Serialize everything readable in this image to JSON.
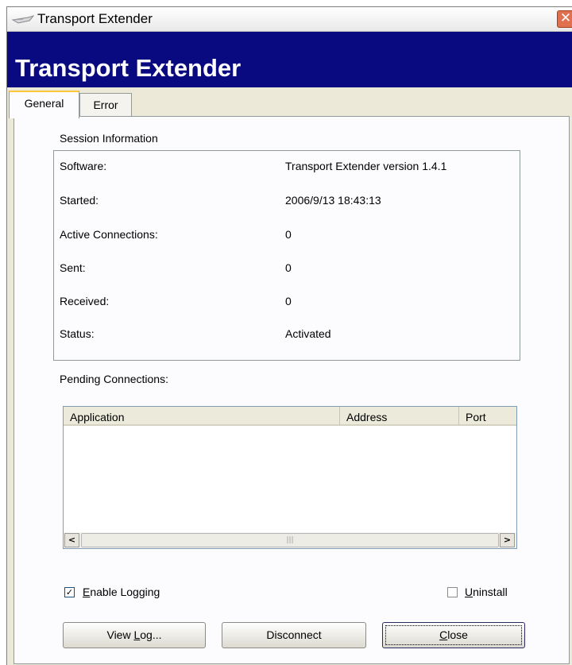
{
  "window": {
    "title": "Transport Extender",
    "banner_title": "Transport Extender",
    "close_glyph": "✕"
  },
  "tabs": [
    {
      "label": "General",
      "active": true
    },
    {
      "label": "Error",
      "active": false
    }
  ],
  "session": {
    "heading": "Session Information",
    "rows": [
      {
        "label": "Software:",
        "value": "Transport Extender version 1.4.1"
      },
      {
        "label": "Started:",
        "value": "2006/9/13  18:43:13"
      },
      {
        "label": "Active Connections:",
        "value": "0"
      },
      {
        "label": "Sent:",
        "value": "0"
      },
      {
        "label": "Received:",
        "value": "0"
      },
      {
        "label": "Status:",
        "value": "Activated"
      }
    ]
  },
  "pending": {
    "heading": "Pending Connections:",
    "columns": [
      "Application",
      "Address",
      "Port"
    ],
    "rows": [],
    "scroll_left": "<",
    "scroll_right": ">",
    "thumb_grip": "|||"
  },
  "options": {
    "enable_logging": {
      "label_first": "E",
      "label_rest": "nable Logging",
      "checked": true
    },
    "uninstall": {
      "label_first": "U",
      "label_rest": "ninstall",
      "checked": false
    }
  },
  "buttons": {
    "view_log": {
      "first": "View ",
      "mnemonic": "L",
      "rest": "og..."
    },
    "disconnect": "Disconnect",
    "close": {
      "mnemonic": "C",
      "rest": "lose"
    }
  },
  "colors": {
    "banner_bg": "#0a0a80",
    "dialog_bg": "#ece9d8"
  }
}
